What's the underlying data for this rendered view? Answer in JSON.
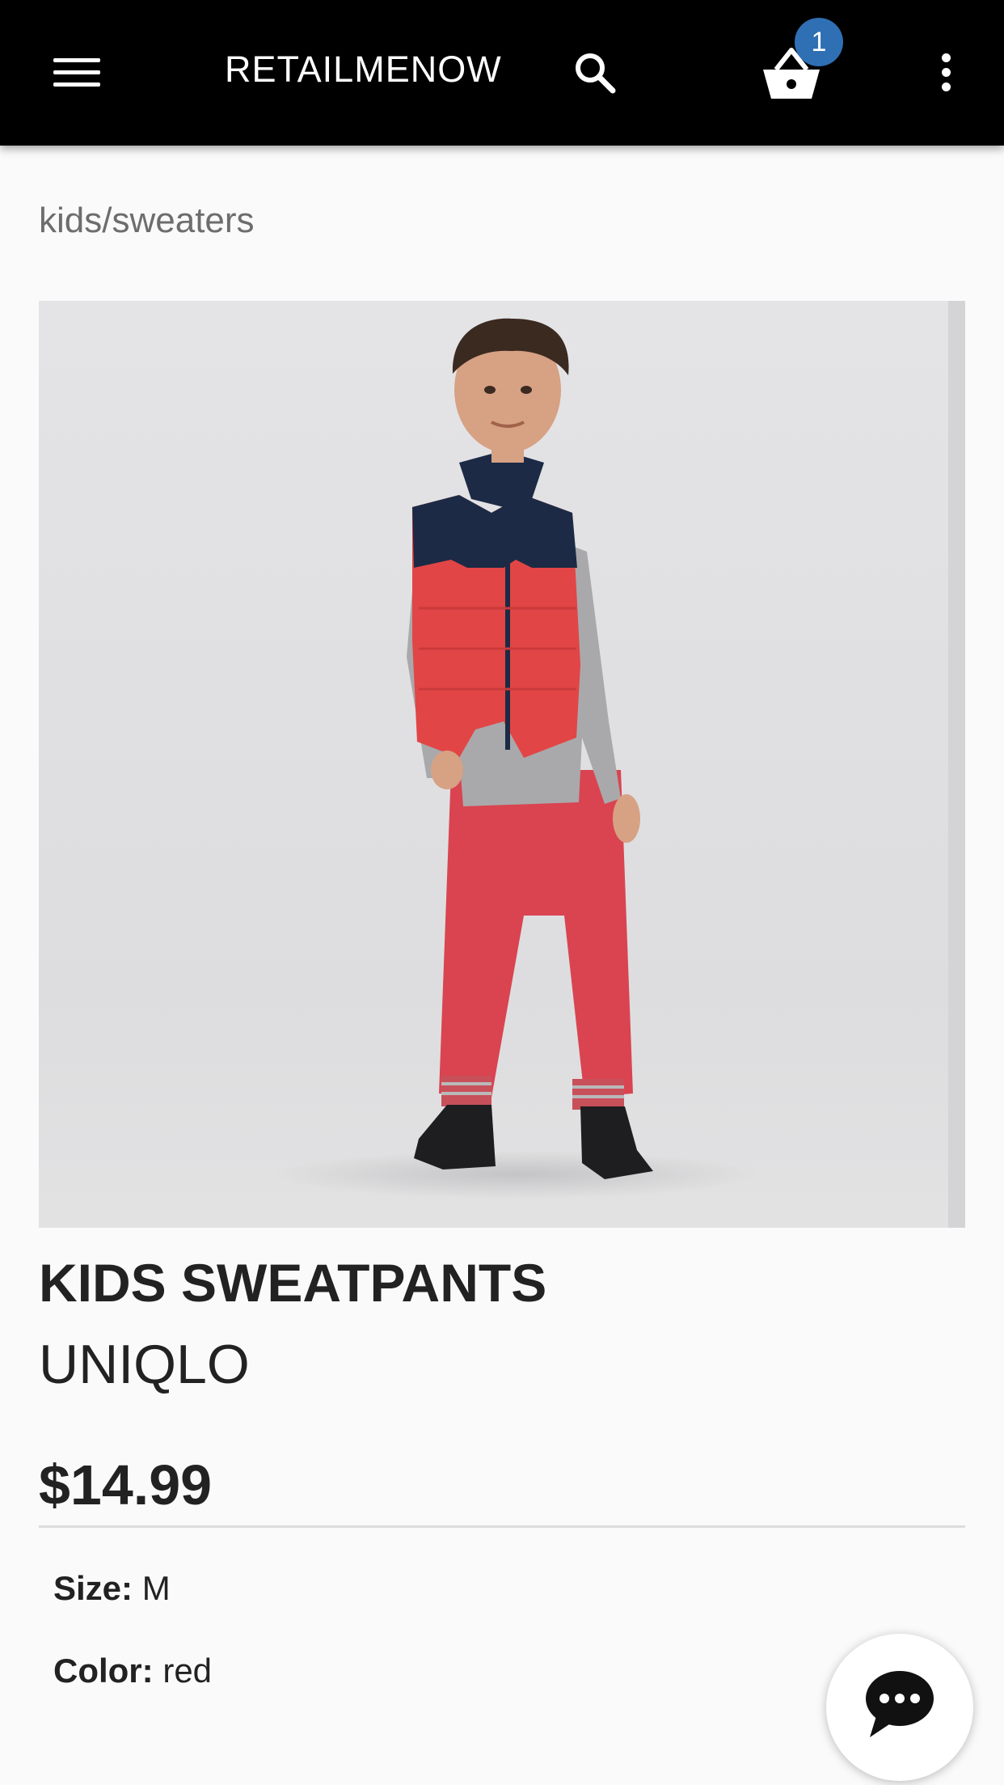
{
  "app_bar": {
    "title": "RETAILMENOW",
    "cart_count": "1",
    "icons": [
      "menu-icon",
      "search-icon",
      "basket-icon",
      "more-vert-icon"
    ],
    "background": "#000000",
    "badge_color": "#2f6fb4"
  },
  "breadcrumb": "kids/sweaters",
  "product": {
    "title": "KIDS SWEATPANTS",
    "brand": "UNIQLO",
    "price": "$14.99",
    "attributes": [
      {
        "label": "Size:",
        "value": "M"
      },
      {
        "label": "Color:",
        "value": "red"
      }
    ]
  },
  "chat": {
    "icon": "chat-bubble-icon"
  }
}
